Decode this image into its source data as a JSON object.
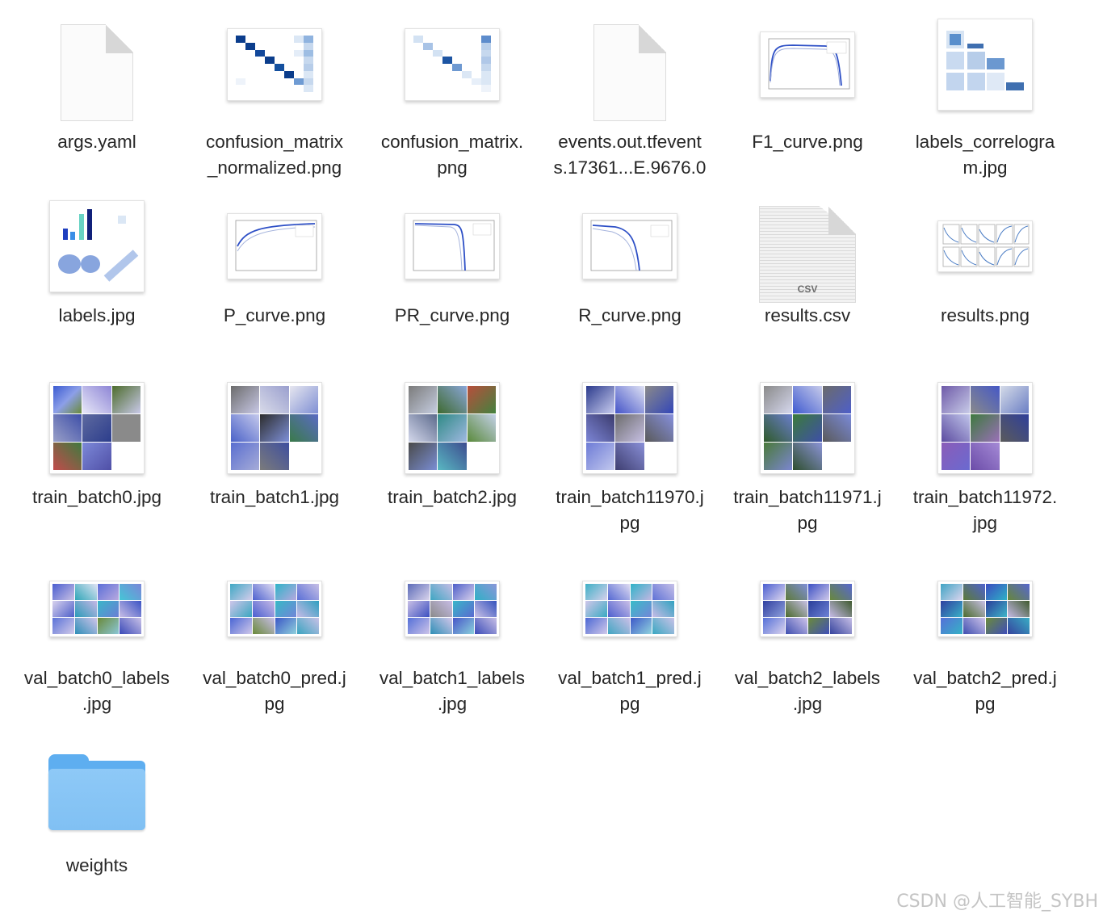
{
  "files": [
    {
      "name": "args.yaml",
      "kind": "document"
    },
    {
      "name": "confusion_matrix_normalized.png",
      "kind": "confusion-matrix"
    },
    {
      "name": "confusion_matrix.png",
      "kind": "confusion-matrix"
    },
    {
      "name": "events.out.tfevents.17361...E.9676.0",
      "kind": "document"
    },
    {
      "name": "F1_curve.png",
      "kind": "curve-plot"
    },
    {
      "name": "labels_correlogram.jpg",
      "kind": "correlogram"
    },
    {
      "name": "labels.jpg",
      "kind": "labels-plot"
    },
    {
      "name": "P_curve.png",
      "kind": "curve-plot"
    },
    {
      "name": "PR_curve.png",
      "kind": "curve-plot"
    },
    {
      "name": "R_curve.png",
      "kind": "curve-plot"
    },
    {
      "name": "results.csv",
      "kind": "csv",
      "badge": "CSV"
    },
    {
      "name": "results.png",
      "kind": "results-plot"
    },
    {
      "name": "train_batch0.jpg",
      "kind": "batch-mosaic"
    },
    {
      "name": "train_batch1.jpg",
      "kind": "batch-mosaic"
    },
    {
      "name": "train_batch2.jpg",
      "kind": "batch-mosaic"
    },
    {
      "name": "train_batch11970.jpg",
      "kind": "batch-mosaic"
    },
    {
      "name": "train_batch11971.jpg",
      "kind": "batch-mosaic"
    },
    {
      "name": "train_batch11972.jpg",
      "kind": "batch-mosaic"
    },
    {
      "name": "val_batch0_labels.jpg",
      "kind": "val-mosaic"
    },
    {
      "name": "val_batch0_pred.jpg",
      "kind": "val-mosaic"
    },
    {
      "name": "val_batch1_labels.jpg",
      "kind": "val-mosaic"
    },
    {
      "name": "val_batch1_pred.jpg",
      "kind": "val-mosaic"
    },
    {
      "name": "val_batch2_labels.jpg",
      "kind": "val-mosaic"
    },
    {
      "name": "val_batch2_pred.jpg",
      "kind": "val-mosaic"
    },
    {
      "name": "weights",
      "kind": "folder"
    }
  ],
  "labels": {
    "args": "args.yaml",
    "cmn_1": "confusion_matrix",
    "cmn_2": "_normalized.png",
    "cm_1": "confusion_matrix.",
    "cm_2": "png",
    "ev_1": "events.out.tfevent",
    "ev_2": "s.17361...E.9676.0",
    "f1": "F1_curve.png",
    "corr_1": "labels_correlogra",
    "corr_2": "m.jpg",
    "labels": "labels.jpg",
    "p": "P_curve.png",
    "pr": "PR_curve.png",
    "r": "R_curve.png",
    "csv": "results.csv",
    "res": "results.png",
    "tb0": "train_batch0.jpg",
    "tb1": "train_batch1.jpg",
    "tb2": "train_batch2.jpg",
    "tb11970_1": "train_batch11970.j",
    "tb11970_2": "pg",
    "tb11971_1": "train_batch11971.j",
    "tb11971_2": "pg",
    "tb11972_1": "train_batch11972.",
    "tb11972_2": "jpg",
    "v0l_1": "val_batch0_labels",
    "v0l_2": ".jpg",
    "v0p_1": "val_batch0_pred.j",
    "v0p_2": "pg",
    "v1l_1": "val_batch1_labels",
    "v1l_2": ".jpg",
    "v1p_1": "val_batch1_pred.j",
    "v1p_2": "pg",
    "v2l_1": "val_batch2_labels",
    "v2l_2": ".jpg",
    "v2p_1": "val_batch2_pred.j",
    "v2p_2": "pg",
    "weights": "weights",
    "csv_badge": "CSV"
  },
  "watermark": "CSDN @人工智能_SYBH"
}
